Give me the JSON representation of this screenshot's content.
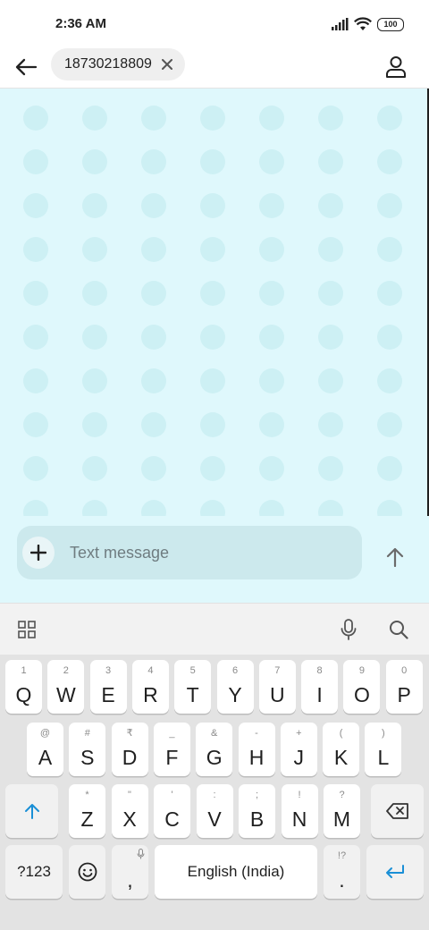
{
  "status_bar": {
    "time": "2:36 AM",
    "battery": "100"
  },
  "header": {
    "recipient": "18730218809"
  },
  "compose": {
    "placeholder": "Text message"
  },
  "keyboard": {
    "row1": [
      {
        "main": "Q",
        "alt": "1"
      },
      {
        "main": "W",
        "alt": "2"
      },
      {
        "main": "E",
        "alt": "3"
      },
      {
        "main": "R",
        "alt": "4"
      },
      {
        "main": "T",
        "alt": "5"
      },
      {
        "main": "Y",
        "alt": "6"
      },
      {
        "main": "U",
        "alt": "7"
      },
      {
        "main": "I",
        "alt": "8"
      },
      {
        "main": "O",
        "alt": "9"
      },
      {
        "main": "P",
        "alt": "0"
      }
    ],
    "row2": [
      {
        "main": "A",
        "alt": "@"
      },
      {
        "main": "S",
        "alt": "#"
      },
      {
        "main": "D",
        "alt": "₹"
      },
      {
        "main": "F",
        "alt": "_"
      },
      {
        "main": "G",
        "alt": "&"
      },
      {
        "main": "H",
        "alt": "-"
      },
      {
        "main": "J",
        "alt": "+"
      },
      {
        "main": "K",
        "alt": "("
      },
      {
        "main": "L",
        "alt": ")"
      }
    ],
    "row3": [
      {
        "main": "Z",
        "alt": "*"
      },
      {
        "main": "X",
        "alt": "\""
      },
      {
        "main": "C",
        "alt": "'"
      },
      {
        "main": "V",
        "alt": ":"
      },
      {
        "main": "B",
        "alt": ";"
      },
      {
        "main": "N",
        "alt": "!"
      },
      {
        "main": "M",
        "alt": "?"
      }
    ],
    "symbols_label": "?123",
    "comma": ",",
    "space_label": "English (India)",
    "period": ".",
    "period_alt": "!?"
  },
  "colors": {
    "accent": "#1a8fd6",
    "conversation_bg": "#dff8fc",
    "dot": "#cdf0f4"
  }
}
